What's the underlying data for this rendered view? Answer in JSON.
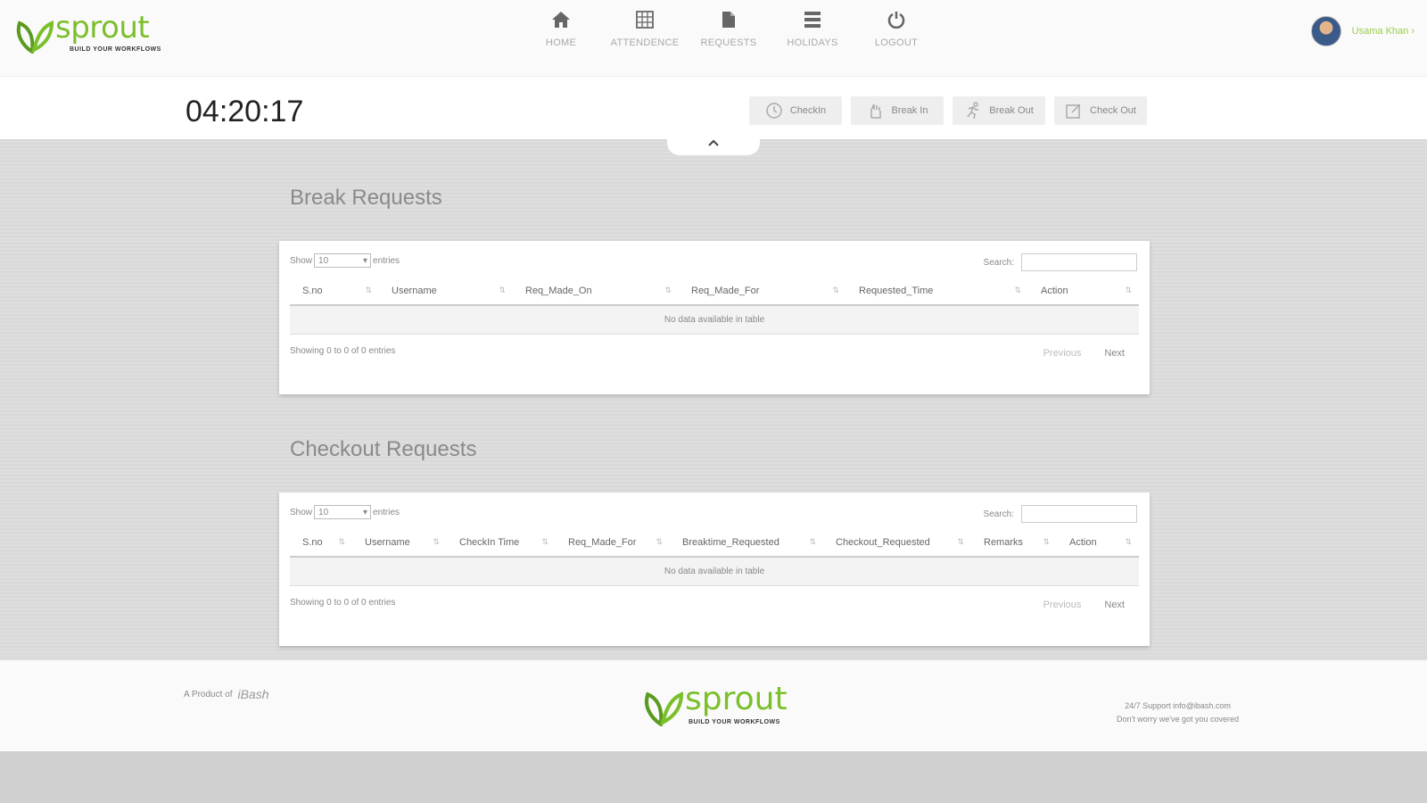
{
  "brand": {
    "name": "sprout",
    "tagline": "BUILD YOUR WORKFLOWS",
    "color": "#7bbf2a"
  },
  "nav": [
    {
      "label": "HOME",
      "icon": "home-icon"
    },
    {
      "label": "ATTENDENCE",
      "icon": "grid-icon"
    },
    {
      "label": "REQUESTS",
      "icon": "document-icon"
    },
    {
      "label": "HOLIDAYS",
      "icon": "list-icon"
    },
    {
      "label": "LOGOUT",
      "icon": "power-icon"
    }
  ],
  "user": {
    "name": "Usama Khan"
  },
  "clock": "04:20:17",
  "actions": [
    {
      "label": "CheckIn",
      "icon": "clock-icon"
    },
    {
      "label": "Break In",
      "icon": "hand-icon"
    },
    {
      "label": "Break Out",
      "icon": "running-icon"
    },
    {
      "label": "Check Out",
      "icon": "edit-icon"
    }
  ],
  "break_requests": {
    "title": "Break Requests",
    "show_label": "Show",
    "entries_value": "10",
    "entries_label": "entries",
    "search_label": "Search:",
    "columns": [
      "S.no",
      "Username",
      "Req_Made_On",
      "Req_Made_For",
      "Requested_Time",
      "Action"
    ],
    "empty_text": "No data available in table",
    "info": "Showing 0 to 0 of 0 entries",
    "prev": "Previous",
    "next": "Next"
  },
  "checkout_requests": {
    "title": "Checkout Requests",
    "show_label": "Show",
    "entries_value": "10",
    "entries_label": "entries",
    "search_label": "Search:",
    "columns": [
      "S.no",
      "Username",
      "CheckIn Time",
      "Req_Made_For",
      "Breaktime_Requested",
      "Checkout_Requested",
      "Remarks",
      "Action"
    ],
    "empty_text": "No data available in table",
    "info": "Showing 0 to 0 of 0 entries",
    "prev": "Previous",
    "next": "Next"
  },
  "footer": {
    "product_label": "A Product of",
    "company": "iBash",
    "support_line1": "24/7 Support info@ibash.com",
    "support_line2": "Don't worry we've got you covered"
  }
}
